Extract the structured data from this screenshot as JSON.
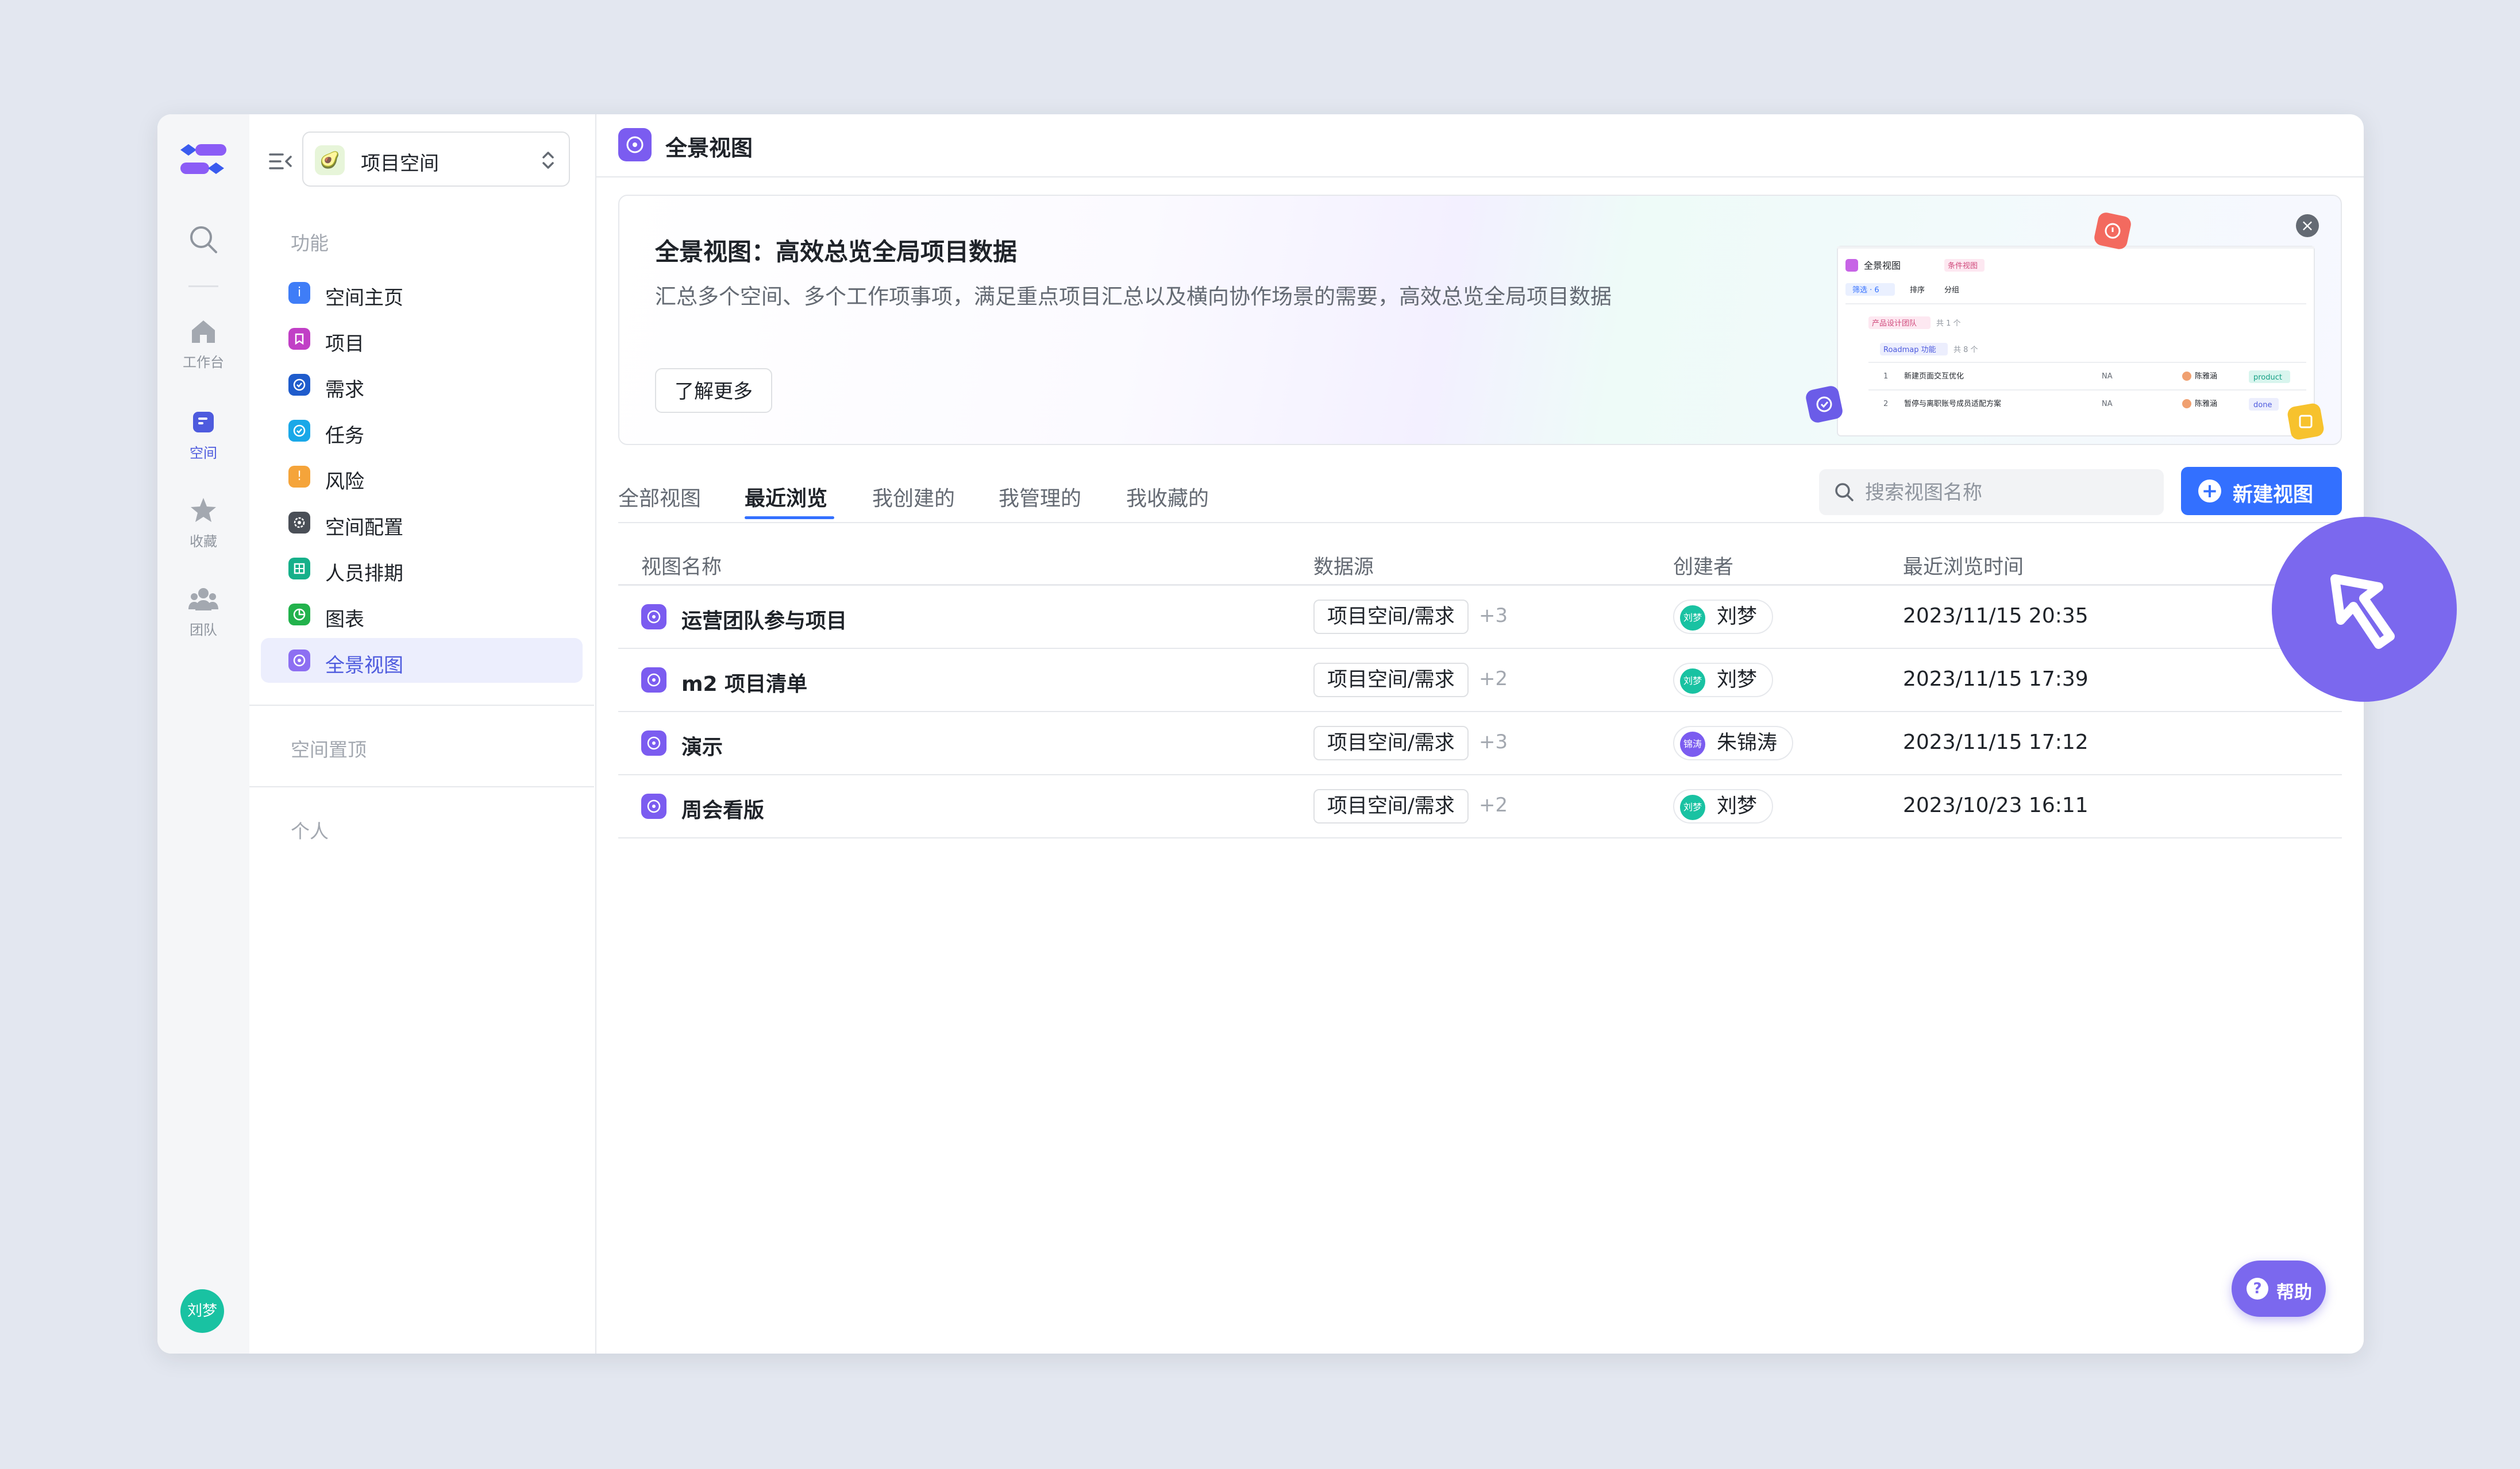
{
  "rail": {
    "items": [
      {
        "label": "工作台",
        "icon": "home-icon"
      },
      {
        "label": "空间",
        "icon": "space-icon"
      },
      {
        "label": "收藏",
        "icon": "star-icon"
      },
      {
        "label": "团队",
        "icon": "team-icon"
      }
    ],
    "avatar": "刘梦"
  },
  "sidebar": {
    "space_name": "项目空间",
    "section_function": "功能",
    "items": [
      {
        "label": "空间主页",
        "color": "#3f7df7",
        "icon": "info-icon"
      },
      {
        "label": "项目",
        "color": "#c13fc6",
        "icon": "bookmark-icon"
      },
      {
        "label": "需求",
        "color": "#1f5ccc",
        "icon": "check-circle-icon"
      },
      {
        "label": "任务",
        "color": "#1aa8e8",
        "icon": "check-circle-icon"
      },
      {
        "label": "风险",
        "color": "#f5a43a",
        "icon": "alert-icon"
      },
      {
        "label": "空间配置",
        "color": "#4a4f57",
        "icon": "settings-icon"
      },
      {
        "label": "人员排期",
        "color": "#16b08a",
        "icon": "calendar-grid-icon"
      },
      {
        "label": "图表",
        "color": "#22b24c",
        "icon": "chart-icon"
      },
      {
        "label": "全景视图",
        "color": "#8d6ff2",
        "icon": "panorama-icon"
      }
    ],
    "section_pinned": "空间置顶",
    "section_personal": "个人"
  },
  "header": {
    "title": "全景视图"
  },
  "banner": {
    "title": "全景视图：高效总览全局项目数据",
    "description": "汇总多个空间、多个工作项事项，满足重点项目汇总以及横向协作场景的需要，高效总览全局项目数据",
    "button": "了解更多",
    "preview": {
      "title": "全景视图",
      "badge": "条件视图",
      "filter": "筛选 · 6",
      "sort": "排序",
      "group": "分组",
      "group1": "产品设计团队",
      "group1_count": "共 1 个",
      "group2": "Roadmap 功能",
      "group2_count": "共 8 个",
      "rows": [
        {
          "no": "1",
          "name": "新建页面交互优化",
          "value": "NA",
          "owner": "陈雅涵",
          "tag": "product"
        },
        {
          "no": "2",
          "name": "暂停与离职账号成员适配方案",
          "value": "NA",
          "owner": "陈雅涵",
          "tag": "done"
        }
      ]
    }
  },
  "tabs": [
    "全部视图",
    "最近浏览",
    "我创建的",
    "我管理的",
    "我收藏的"
  ],
  "active_tab": "最近浏览",
  "search": {
    "placeholder": "搜索视图名称"
  },
  "new_view_button": "新建视图",
  "table": {
    "columns": [
      "视图名称",
      "数据源",
      "创建者",
      "最近浏览时间"
    ],
    "rows": [
      {
        "name": "运营团队参与项目",
        "source": "项目空间/需求",
        "more": "+3",
        "creator": "刘梦",
        "avatar": "刘梦",
        "avatar_color": "#19c2a2",
        "time": "2023/11/15 20:35"
      },
      {
        "name": "m2 项目清单",
        "source": "项目空间/需求",
        "more": "+2",
        "creator": "刘梦",
        "avatar": "刘梦",
        "avatar_color": "#19c2a2",
        "time": "2023/11/15 17:39"
      },
      {
        "name": "演示",
        "source": "项目空间/需求",
        "more": "+3",
        "creator": "朱锦涛",
        "avatar": "锦涛",
        "avatar_color": "#7b5cf0",
        "time": "2023/11/15 17:12"
      },
      {
        "name": "周会看版",
        "source": "项目空间/需求",
        "more": "+2",
        "creator": "刘梦",
        "avatar": "刘梦",
        "avatar_color": "#19c2a2",
        "time": "2023/10/23 16:11"
      }
    ]
  },
  "help_button": "帮助",
  "colors": {
    "accent": "#3370ff",
    "brand_purple": "#7b68ee"
  }
}
